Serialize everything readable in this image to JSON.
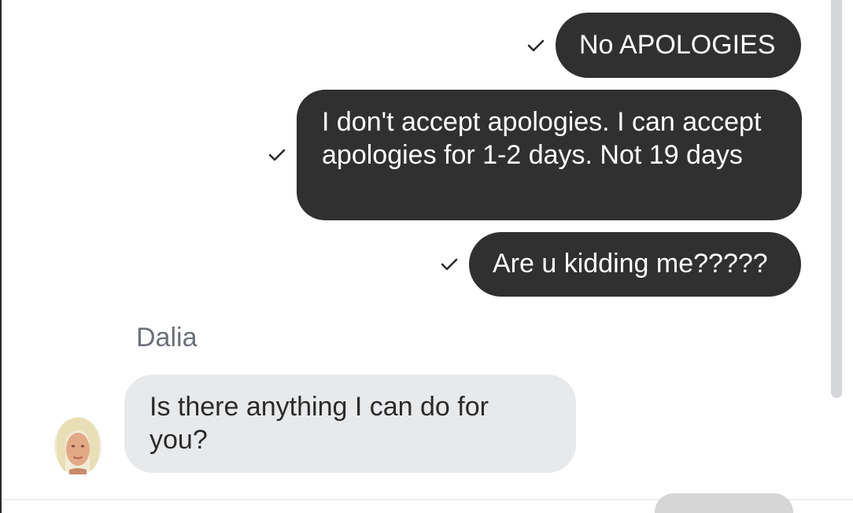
{
  "messages": [
    {
      "direction": "outgoing",
      "status_icon": "check-icon",
      "text": "No APOLOGIES"
    },
    {
      "direction": "outgoing",
      "status_icon": "check-icon",
      "text": "I don't accept apologies. I can accept apologies for 1-2 days. Not 19 days"
    },
    {
      "direction": "outgoing",
      "status_icon": "check-icon",
      "text": "Are u kidding me?????"
    },
    {
      "direction": "incoming",
      "sender": "Dalia",
      "avatar": "avatar-icon",
      "text": "Is there anything I can do for you?"
    }
  ],
  "colors": {
    "outgoing_bubble": "#303030",
    "outgoing_text": "#ffffff",
    "incoming_bubble": "#e8e9eb",
    "incoming_text": "#2a2a2a",
    "sender_name": "#6b7078"
  }
}
